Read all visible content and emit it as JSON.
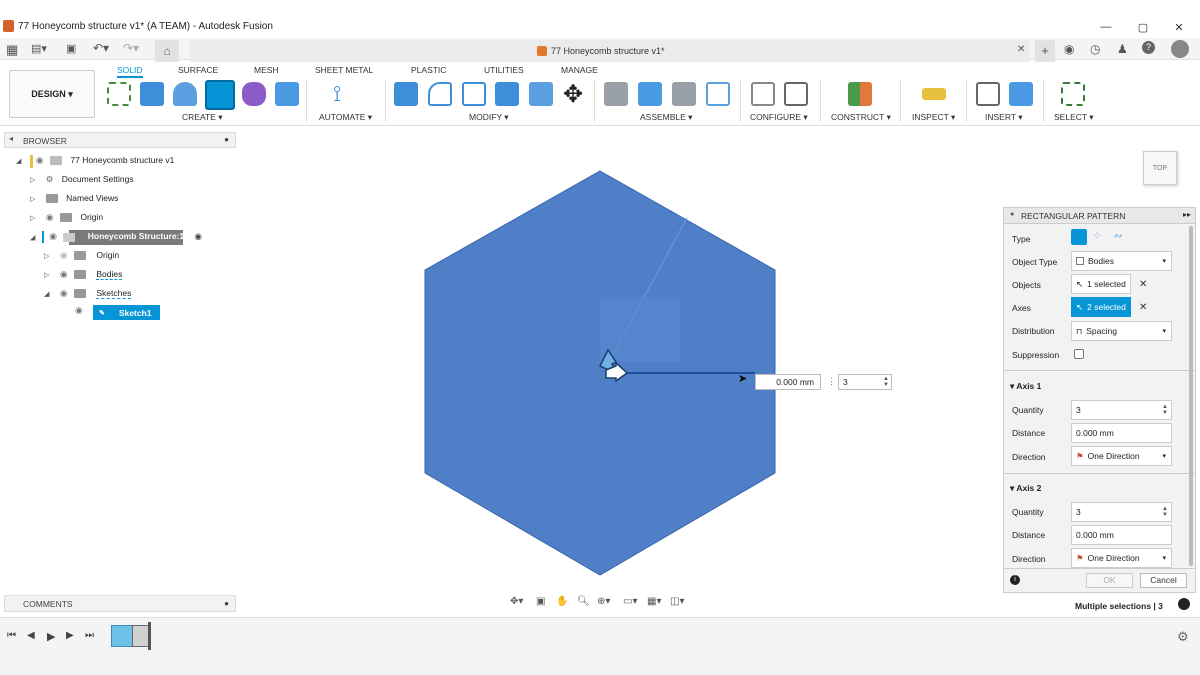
{
  "app": {
    "window_title": "77 Honeycomb structure v1* (A TEAM) - Autodesk Fusion",
    "doc_tab_title": "77 Honeycomb structure v1*"
  },
  "ribbon": {
    "design_button": "DESIGN ▾",
    "tabs": [
      "SOLID",
      "SURFACE",
      "MESH",
      "SHEET METAL",
      "PLASTIC",
      "UTILITIES",
      "MANAGE"
    ],
    "groups": [
      "CREATE ▾",
      "AUTOMATE ▾",
      "MODIFY ▾",
      "ASSEMBLE ▾",
      "CONFIGURE ▾",
      "CONSTRUCT ▾",
      "INSPECT ▾",
      "INSERT ▾",
      "SELECT ▾"
    ]
  },
  "browser": {
    "header": "BROWSER",
    "items": [
      {
        "label": "77 Honeycomb structure v1"
      },
      {
        "label": "Document Settings"
      },
      {
        "label": "Named Views"
      },
      {
        "label": "Origin"
      },
      {
        "label": "Honeycomb Structure:1"
      },
      {
        "label": "Origin"
      },
      {
        "label": "Bodies"
      },
      {
        "label": "Sketches"
      },
      {
        "label": "Sketch1"
      }
    ]
  },
  "comments": {
    "label": "COMMENTS"
  },
  "viewcube": {
    "label": "TOP"
  },
  "canvas": {
    "distance_input": "0.000 mm",
    "quantity_input": "3",
    "colors": {
      "body": "#4f7fc7",
      "body_edge": "#3a66ad"
    }
  },
  "panel": {
    "title": "RECTANGULAR PATTERN",
    "type_label": "Type",
    "object_type_label": "Object Type",
    "object_type_value": "Bodies",
    "objects_label": "Objects",
    "objects_value": "1 selected",
    "axes_label": "Axes",
    "axes_value": "2 selected",
    "distribution_label": "Distribution",
    "distribution_value": "Spacing",
    "suppression_label": "Suppression",
    "axis1": {
      "header": "Axis 1",
      "quantity_label": "Quantity",
      "quantity": "3",
      "distance_label": "Distance",
      "distance": "0.000 mm",
      "direction_label": "Direction",
      "direction": "One Direction"
    },
    "axis2": {
      "header": "Axis 2",
      "quantity_label": "Quantity",
      "quantity": "3",
      "distance_label": "Distance",
      "distance": "0.000 mm",
      "direction_label": "Direction",
      "direction": "One Direction"
    },
    "ok": "OK",
    "cancel": "Cancel"
  },
  "status": {
    "text": "Multiple selections | 3"
  },
  "colors": {
    "accent": "#0696d7",
    "selected_bg": "#0696d7"
  }
}
